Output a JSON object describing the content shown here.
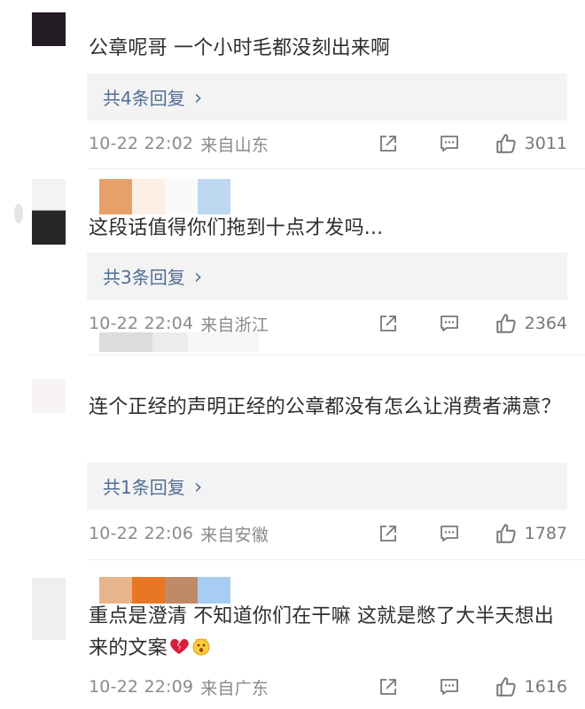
{
  "comments": [
    {
      "text": "公章呢哥 一个小时毛都没刻出来啊",
      "reply_label": "共4条回复",
      "time": "10-22 22:02",
      "location": "来自山东",
      "likes": "3011"
    },
    {
      "text": "这段话值得你们拖到十点才发吗...",
      "reply_label": "共3条回复",
      "time": "10-22 22:04",
      "location": "来自浙江",
      "likes": "2364",
      "name_blur_colors": [
        "#e8a06b",
        "#fcefe6",
        "#fafafa",
        "#bfd8f2"
      ]
    },
    {
      "text": "连个正经的声明正经的公章都没有怎么让消费者满意？",
      "reply_label": "共1条回复",
      "time": "10-22 22:06",
      "location": "来自安徽",
      "likes": "1787"
    },
    {
      "text": "重点是澄清 不知道你们在干嘛 这就是憋了大半天想出来的文案",
      "time": "10-22 22:09",
      "location": "来自广东",
      "likes": "1616",
      "name_blur_colors": [
        "#e8b48c",
        "#e97624",
        "#c08a66",
        "#a7cdf2"
      ],
      "emojis": [
        "broken-heart-emoji",
        "astonished-emoji"
      ]
    }
  ],
  "icons": {
    "share": "share-icon",
    "comment": "comment-icon",
    "like": "thumbs-up-icon",
    "chevron": "chevron-right-icon"
  },
  "colors": {
    "reply_link": "#4f6e96",
    "reply_bg": "#f3f3f3",
    "meta_text": "#8a8a8a"
  }
}
